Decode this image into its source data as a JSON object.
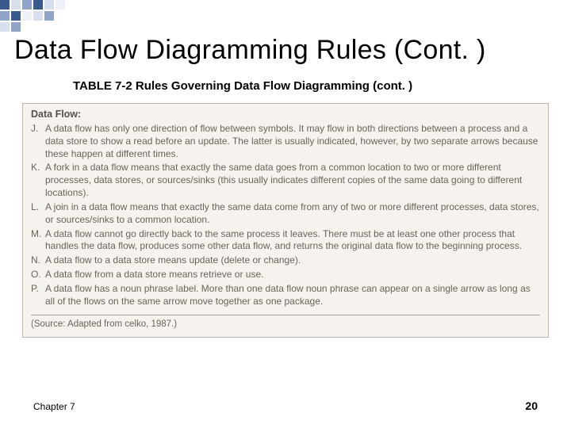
{
  "decoration": {
    "colors": {
      "dark": "#395a8d",
      "mid": "#8fa4c7",
      "light": "#d7dfec",
      "pale": "#eef2f8"
    }
  },
  "title": "Data Flow Diagramming Rules (Cont. )",
  "subtitle": "TABLE 7-2 Rules Governing Data Flow Diagramming (cont. )",
  "section_head": "Data Flow:",
  "rules": [
    {
      "letter": "J.",
      "text": "A data flow has only one direction of flow between symbols. It may flow in both directions between a process and a data store to show a read before an update. The latter is usually indicated, however, by two separate arrows because these happen at different times."
    },
    {
      "letter": "K.",
      "text": "A fork in a data flow means that exactly the same data goes from a common location to two or more different processes, data stores, or sources/sinks (this usually indicates different copies of the same data going to different locations)."
    },
    {
      "letter": "L.",
      "text": "A join in a data flow means that exactly the same data come from any of two or more different processes, data stores, or sources/sinks to a common location."
    },
    {
      "letter": "M.",
      "text": "A data flow cannot go directly back to the same process it leaves. There must be at least one other process that handles the data flow, produces some other data flow, and returns the original data flow to the beginning process."
    },
    {
      "letter": "N.",
      "text": "A data flow to a data store means update (delete or change)."
    },
    {
      "letter": "O.",
      "text": "A data flow from a data store means retrieve or use."
    },
    {
      "letter": "P.",
      "text": "A data flow has a noun phrase label. More than one data flow noun phrase can appear on a single arrow as long as all of the flows on the same arrow move together as one package."
    }
  ],
  "source": "(Source: Adapted from celko, 1987.)",
  "footer": {
    "left": "Chapter 7",
    "right": "20"
  }
}
